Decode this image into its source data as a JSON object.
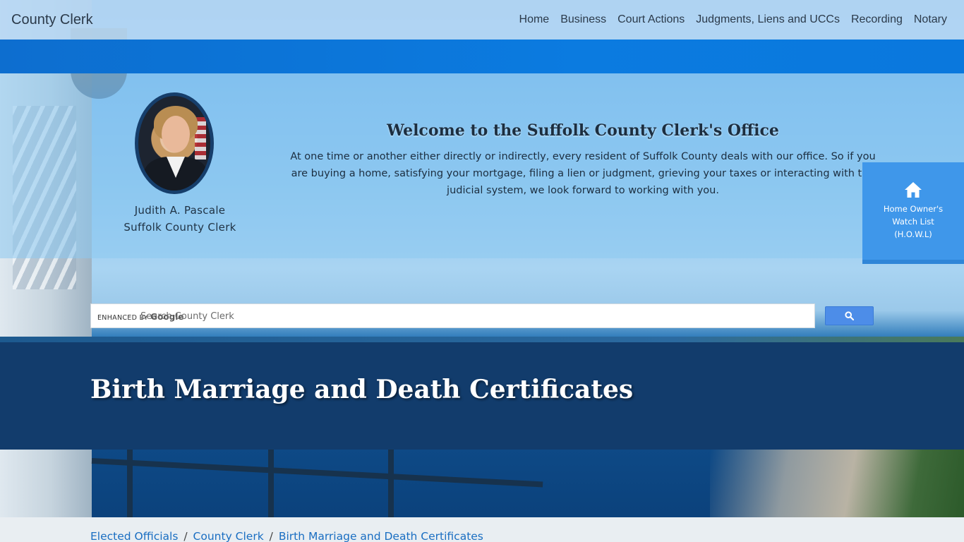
{
  "navbar": {
    "brand": "County Clerk",
    "items": [
      {
        "label": "Home"
      },
      {
        "label": "Business"
      },
      {
        "label": "Court Actions"
      },
      {
        "label": "Judgments, Liens and UCCs"
      },
      {
        "label": "Recording"
      },
      {
        "label": "Notary"
      }
    ]
  },
  "welcome": {
    "clerk_name": "Judith A. Pascale",
    "clerk_title": "Suffolk County Clerk",
    "title": "Welcome to the Suffolk County Clerk's Office",
    "text": "At one time or another either directly or indirectly, every resident of Suffolk County deals with our office. So if you are buying a home, satisfying your mortgage, filing a lien or judgment, grieving your taxes or interacting with the judicial system, we look forward to working with you."
  },
  "howl": {
    "icon": "home-icon",
    "line1": "Home Owner's",
    "line2": "Watch List",
    "line3": "(H.O.W.L)"
  },
  "search": {
    "brand_prefix": "ENHANCED BY",
    "brand_name": "Google",
    "placeholder": "Search County Clerk",
    "button_icon": "search-icon"
  },
  "page": {
    "title": "Birth Marriage and Death Certificates"
  },
  "breadcrumb": {
    "items": [
      {
        "label": "Elected Officials"
      },
      {
        "label": "County Clerk"
      },
      {
        "label": "Birth Marriage and Death Certificates"
      }
    ],
    "separator": "/"
  },
  "colors": {
    "navbar_bg": "#b6d7f3",
    "title_band": "#123c6c",
    "howl_tile": "#3f97ea",
    "search_button": "#4d8de8",
    "link": "#1a6ec2"
  }
}
